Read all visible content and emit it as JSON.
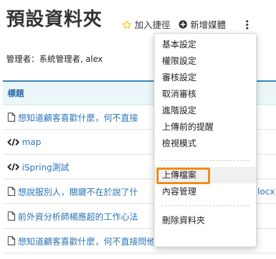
{
  "header": {
    "title": "預設資料夾",
    "add_shortcut_label": "加入捷徑",
    "add_media_label": "新增媒體"
  },
  "manager_line": "管理者：系統管理者, alex",
  "table": {
    "header": "標題",
    "rows": [
      {
        "icon": "document-icon",
        "text": "想知道顧客喜歡什麼，何不直接"
      },
      {
        "icon": "code-icon",
        "text": "map"
      },
      {
        "icon": "code-icon",
        "text": "iSpring測試"
      },
      {
        "icon": "document-icon",
        "text": "想說服別人，關鍵不在於說了什"
      },
      {
        "icon": "document-icon",
        "text": "前外資分析師楊應超的工作心法"
      },
      {
        "icon": "document-icon",
        "text": "想知道顧客喜歡什麼，何不直接問他們.docx"
      }
    ],
    "row4_tail": "locx"
  },
  "menu": {
    "group1": [
      "基本設定",
      "權限設定",
      "審核設定",
      "取消審核",
      "進階設定",
      "上傳前的提醒",
      "檢視模式"
    ],
    "group2": [
      "上傳檔案",
      "內容管理"
    ],
    "group3": [
      "刪除資料夾"
    ]
  },
  "colors": {
    "link": "#2a74b8",
    "header_bg": "#eaf6f8",
    "header_rule": "#2f7fb7",
    "star": "#f5c518",
    "highlight": "#f08a12"
  }
}
